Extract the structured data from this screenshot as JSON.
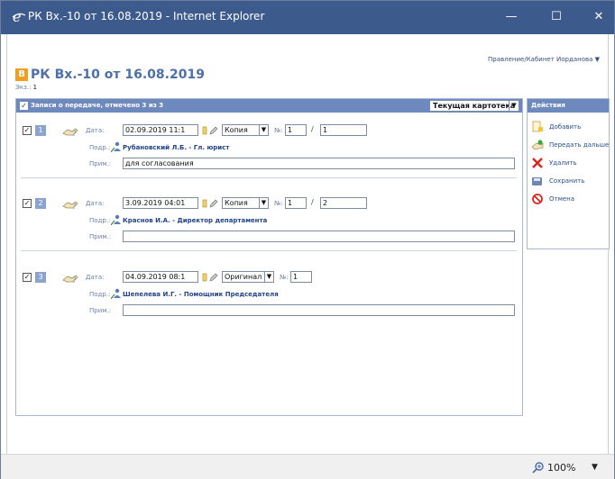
{
  "window": {
    "title": "РК Вх.-10 от 16.08.2019 - Internet Explorer",
    "controls": {
      "minimize": "—",
      "maximize": "☐",
      "close": "✕"
    }
  },
  "breadcrumb": "Правление/Кабинет Иорданова ▼",
  "document": {
    "badge": "В",
    "title": "РК Вх.-10 от 16.08.2019",
    "copies_label": "Экз.:",
    "copies_value": "1"
  },
  "records_panel": {
    "header": "Записи о передаче, отмечено 3 из 3",
    "cabinet_select": "Текущая картотека",
    "labels": {
      "date": "Дата:",
      "no": "№:",
      "dept": "Подр.:",
      "note": "Прим.:"
    },
    "records": [
      {
        "num": "1",
        "checked": "✓",
        "date": "02.09.2019 11:1",
        "type": "Копия",
        "no_a": "1",
        "no_b": "1",
        "person": "Рубановский Л.Б. - Гл. юрист",
        "note": "для согласования"
      },
      {
        "num": "2",
        "checked": "✓",
        "date": "3.09.2019 04:01",
        "type": "Копия",
        "no_a": "1",
        "no_b": "2",
        "person": "Краснов И.А. - Директор департамента",
        "note": ""
      },
      {
        "num": "3",
        "checked": "✓",
        "date": "04.09.2019 08:1",
        "type": "Оригинал",
        "no_a": "1",
        "no_b": "",
        "person": "Шепелева И.Г. - Помощник Председателя",
        "note": ""
      }
    ]
  },
  "actions_panel": {
    "header": "Действия",
    "items": [
      {
        "label": "Добавить",
        "icon": "add-icon"
      },
      {
        "label": "Передать дальше",
        "icon": "forward-icon"
      },
      {
        "label": "Удалить",
        "icon": "delete-icon"
      },
      {
        "label": "Сохранить",
        "icon": "save-icon"
      },
      {
        "label": "Отмена",
        "icon": "cancel-icon"
      }
    ]
  },
  "statusbar": {
    "zoom": "100%"
  },
  "colors": {
    "titlebar": "#3d5a8c",
    "panel_header": "#6e89bd",
    "link": "#21438a",
    "badge": "#f0a01e",
    "delete": "#d9261c"
  }
}
